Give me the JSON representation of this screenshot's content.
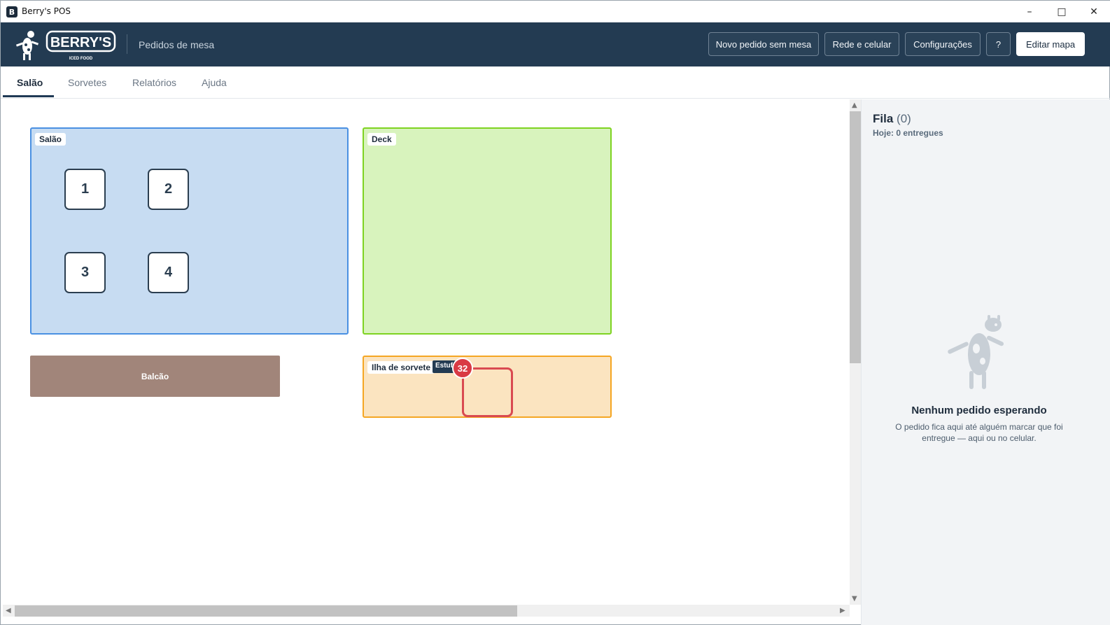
{
  "window": {
    "title": "Berry's POS",
    "icon": "app-icon"
  },
  "header": {
    "logo_text": "BERRY'S",
    "logo_sub": "ICED FOOD",
    "subtitle": "Pedidos de mesa",
    "buttons": {
      "new_order": "Novo pedido sem mesa",
      "network": "Rede e celular",
      "settings": "Configurações",
      "help": "?",
      "edit_map": "Editar mapa"
    }
  },
  "tabs": [
    {
      "label": "Salão",
      "active": true
    },
    {
      "label": "Sorvetes",
      "active": false
    },
    {
      "label": "Relatórios",
      "active": false
    },
    {
      "label": "Ajuda",
      "active": false
    }
  ],
  "map": {
    "zones": {
      "salao": {
        "label": "Salão",
        "color": "#c7dcf2",
        "border": "#4a90e2"
      },
      "deck": {
        "label": "Deck",
        "color": "#d8f3bd",
        "border": "#7ed321"
      },
      "ilha": {
        "label": "Ilha de sorvete",
        "color": "#fbe4c0",
        "border": "#f5a623"
      }
    },
    "tables": [
      "1",
      "2",
      "3",
      "4"
    ],
    "balcao": {
      "label": "Balcão",
      "color": "#a1857a"
    },
    "estufa": {
      "tag": "Estufa",
      "badge": "32"
    }
  },
  "queue": {
    "title": "Fila",
    "count": "(0)",
    "today": "Hoje: 0 entregues",
    "empty_title": "Nenhum pedido esperando",
    "empty_text": "O pedido fica aqui até alguém marcar que foi entregue — aqui ou no celular."
  }
}
